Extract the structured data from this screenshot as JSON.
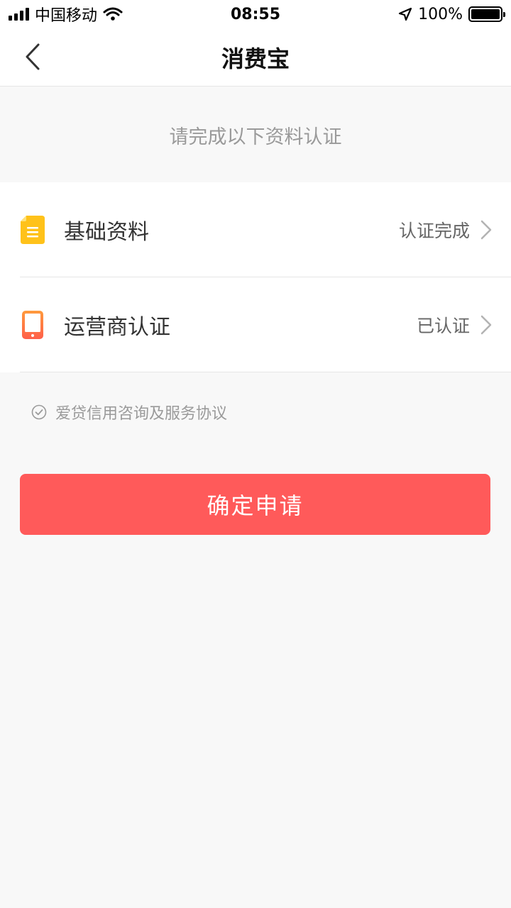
{
  "status_bar": {
    "carrier": "中国移动",
    "time": "08:55",
    "battery_text": "100%",
    "battery_level": 1.0,
    "icons": [
      "signal-icon",
      "wifi-icon",
      "location-arrow-icon",
      "battery-icon"
    ]
  },
  "nav": {
    "title": "消费宝",
    "back_icon": "chevron-left-icon"
  },
  "notice": "请完成以下资料认证",
  "verification_items": [
    {
      "label": "基础资料",
      "status": "认证完成",
      "icon": "document-icon",
      "icon_color": "#FFC21A"
    },
    {
      "label": "运营商认证",
      "status": "已认证",
      "icon": "phone-icon",
      "icon_color": "#FF7A45"
    }
  ],
  "agreement": {
    "text": "爱贷信用咨询及服务协议",
    "checked": true
  },
  "submit": {
    "label": "确定申请",
    "color": "#FF5A5A"
  }
}
